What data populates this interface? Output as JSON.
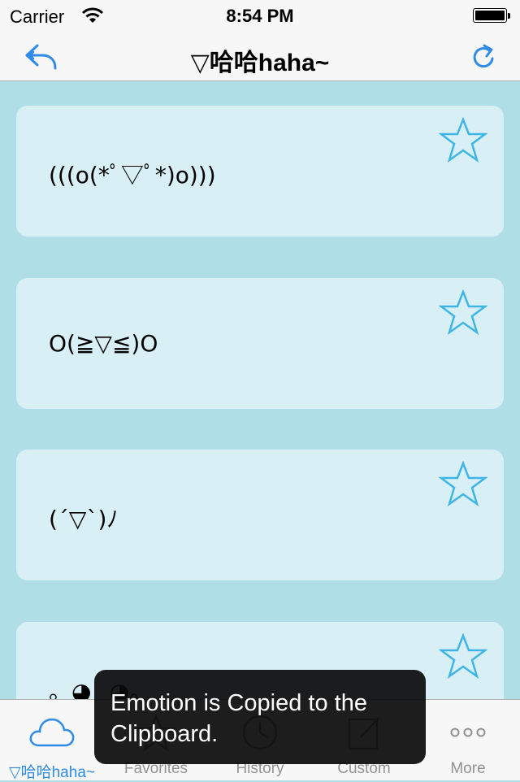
{
  "status": {
    "carrier": "Carrier",
    "time": "8:54 PM"
  },
  "nav": {
    "title": "▽哈哈haha~",
    "back_icon": "reply-back-icon",
    "refresh_icon": "refresh-icon"
  },
  "items": [
    {
      "text": "(((o(*ﾟ▽ﾟ*)o)))",
      "favorited": false
    },
    {
      "text": "O(≧▽≦)O",
      "favorited": false
    },
    {
      "text": "(´▽`)ﾉ",
      "favorited": false
    },
    {
      "text": "。◕‿◕。",
      "favorited": false
    }
  ],
  "tabs": [
    {
      "label": "▽哈哈haha~",
      "icon": "cloud-icon",
      "active": true
    },
    {
      "label": "Favorites",
      "icon": "star-icon",
      "active": false
    },
    {
      "label": "History",
      "icon": "clock-icon",
      "active": false
    },
    {
      "label": "Custom",
      "icon": "edit-icon",
      "active": false
    },
    {
      "label": "More",
      "icon": "more-icon",
      "active": false
    }
  ],
  "toast": {
    "message": "Emotion is Copied to the Clipboard."
  },
  "colors": {
    "accent": "#2f8be8",
    "background": "#b0dee6",
    "card": "#d8f0f5",
    "star": "#3fb5e6"
  }
}
